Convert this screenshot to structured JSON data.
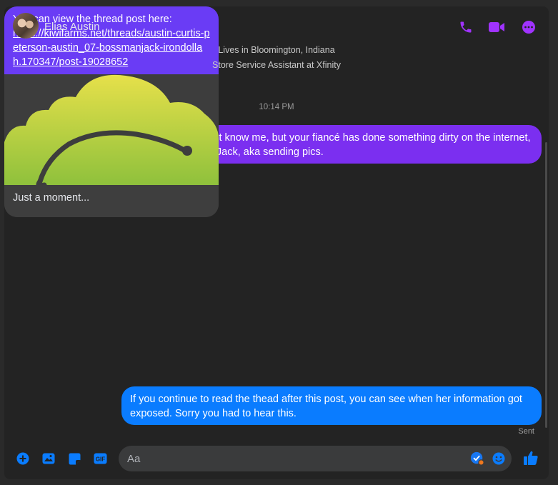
{
  "header": {
    "contact_name": "Elias Austin",
    "accent_color": "#a033ff",
    "icons": [
      "phone-icon",
      "video-camera-icon",
      "more-options-icon"
    ]
  },
  "profile": {
    "location": "Lives in Bloomington, Indiana",
    "job": "Store Service Assistant at Xfinity"
  },
  "thread": {
    "timestamp": "10:14 PM",
    "messages": [
      {
        "text": "Hey Elias. You don't know me, but your fiancé has done something dirty on the internet, involving BossManJack, aka sending pics."
      },
      {
        "intro": "You can view the thread post here:",
        "link": "https://kiwifarms.net/threads/austin-curtis-peterson-austin_07-bossmanjack-irondollah.170347/post-19028652",
        "preview_caption": "Just a moment..."
      },
      {
        "text": "If you continue to read the thead after this post, you can see when her information got exposed. Sorry you had to hear this."
      }
    ],
    "status": "Sent"
  },
  "composer": {
    "placeholder": "Aa",
    "icons": [
      "plus-icon",
      "image-icon",
      "sticker-icon",
      "gif-icon",
      "grammar-check-icon",
      "emoji-icon",
      "thumbs-up-icon"
    ],
    "accent_color": "#0a7cff"
  }
}
